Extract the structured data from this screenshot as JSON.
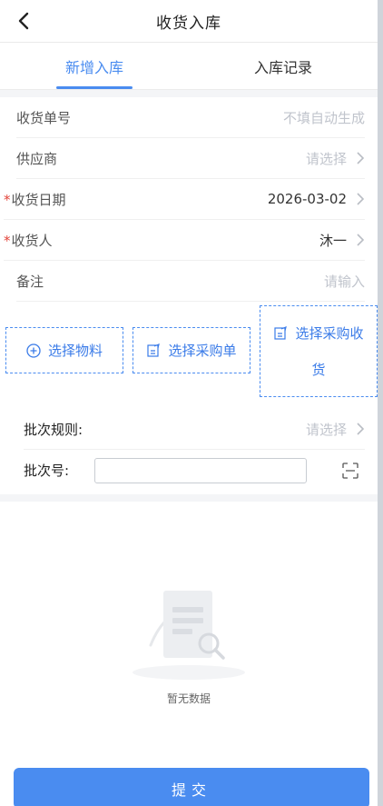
{
  "header": {
    "title": "收货入库"
  },
  "tabs": [
    {
      "label": "新增入库",
      "active": true
    },
    {
      "label": "入库记录",
      "active": false
    }
  ],
  "form": {
    "receipt_no": {
      "label": "收货单号",
      "placeholder": "不填自动生成"
    },
    "supplier": {
      "label": "供应商",
      "placeholder": "请选择"
    },
    "receive_date": {
      "required_mark": "*",
      "label": "收货日期",
      "value": "2026-03-02"
    },
    "receiver": {
      "required_mark": "*",
      "label": "收货人",
      "value": "沐一"
    },
    "remark": {
      "label": "备注",
      "placeholder": "请输入"
    }
  },
  "actions": {
    "select_material": "选择物料",
    "select_purchase_order": "选择采购单",
    "select_purchase_receipt_line1": "选择采购收",
    "select_purchase_receipt_line2": "货"
  },
  "batch": {
    "rule_label": "批次规则:",
    "rule_placeholder": "请选择",
    "no_label": "批次号:",
    "no_value": ""
  },
  "empty": {
    "text": "暂无数据"
  },
  "submit_label": "提交",
  "colors": {
    "accent": "#4a8cf0",
    "required": "#e2443a"
  }
}
